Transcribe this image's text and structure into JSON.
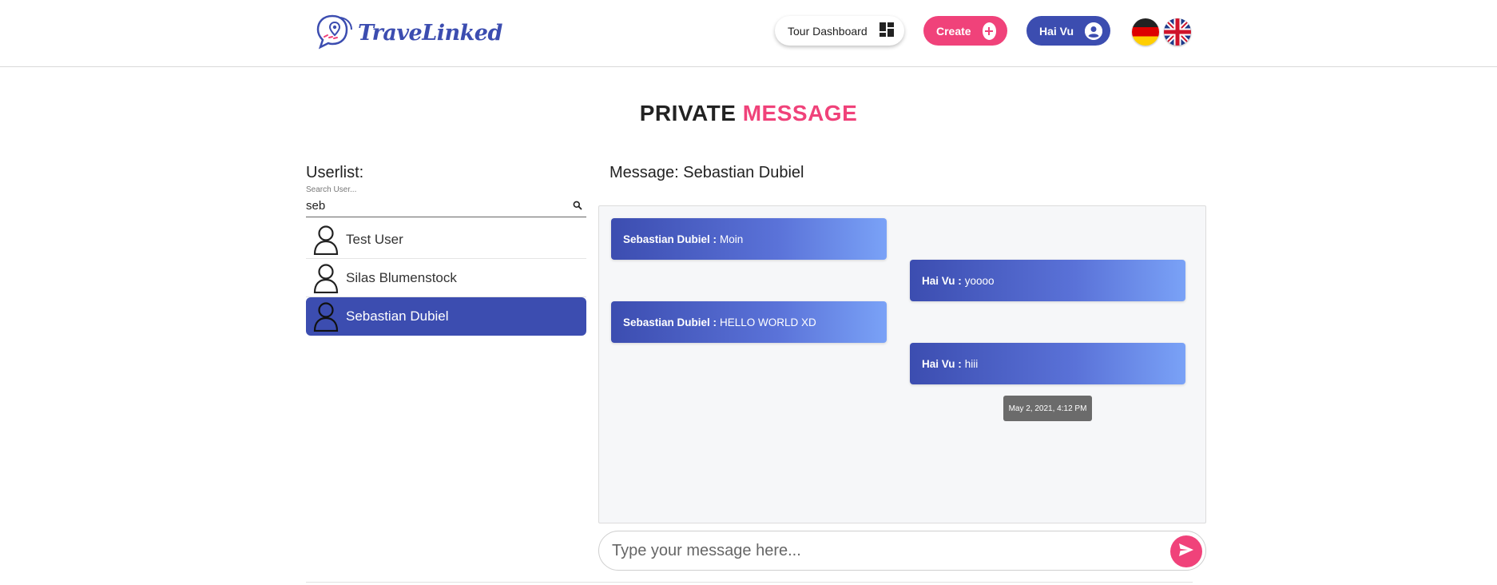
{
  "brand": {
    "name": "TraveLinked",
    "accent": "#3c4db0",
    "pink": "#f0427a"
  },
  "nav": {
    "dashboard_label": "Tour Dashboard",
    "create_label": "Create",
    "user_label": "Hai Vu",
    "languages": [
      "German",
      "English"
    ]
  },
  "page": {
    "title_part1": "PRIVATE",
    "title_part2": "MESSAGE"
  },
  "userlist": {
    "heading": "Userlist:",
    "search_label": "Search User...",
    "search_value": "seb",
    "users": [
      {
        "name": "Test User",
        "selected": false
      },
      {
        "name": "Silas Blumenstock",
        "selected": false
      },
      {
        "name": "Sebastian Dubiel",
        "selected": true
      }
    ]
  },
  "chat": {
    "heading": "Message: Sebastian Dubiel",
    "messages": [
      {
        "sender": "Sebastian Dubiel :",
        "text": "Moin",
        "side": "left"
      },
      {
        "sender": "Hai Vu :",
        "text": "yoooo",
        "side": "right"
      },
      {
        "sender": "Sebastian Dubiel :",
        "text": "HELLO WORLD XD",
        "side": "left"
      },
      {
        "sender": "Hai Vu :",
        "text": "hiii",
        "side": "right"
      }
    ],
    "tooltip": "May 2, 2021, 4:12 PM",
    "composer_placeholder": "Type your message here..."
  }
}
